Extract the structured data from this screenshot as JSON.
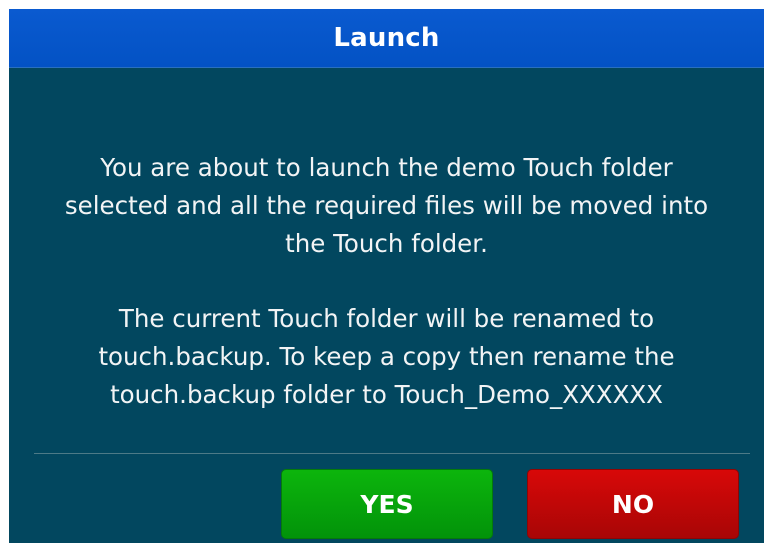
{
  "dialog": {
    "title": "Launch",
    "message": {
      "paragraph_1": "You are about to launch the demo Touch folder\nselected and all the required files will be moved into\nthe Touch folder.",
      "paragraph_2": "The current Touch folder will be renamed to\ntouch.backup. To keep a copy then rename the\ntouch.backup folder to Touch_Demo_XXXXXX"
    },
    "buttons": {
      "yes_label": "YES",
      "no_label": "NO"
    }
  },
  "colors": {
    "title_bar": "#0352c4",
    "body_background": "#02475f",
    "yes_button": "#02930a",
    "no_button": "#a80606",
    "text": "#ffffff"
  }
}
